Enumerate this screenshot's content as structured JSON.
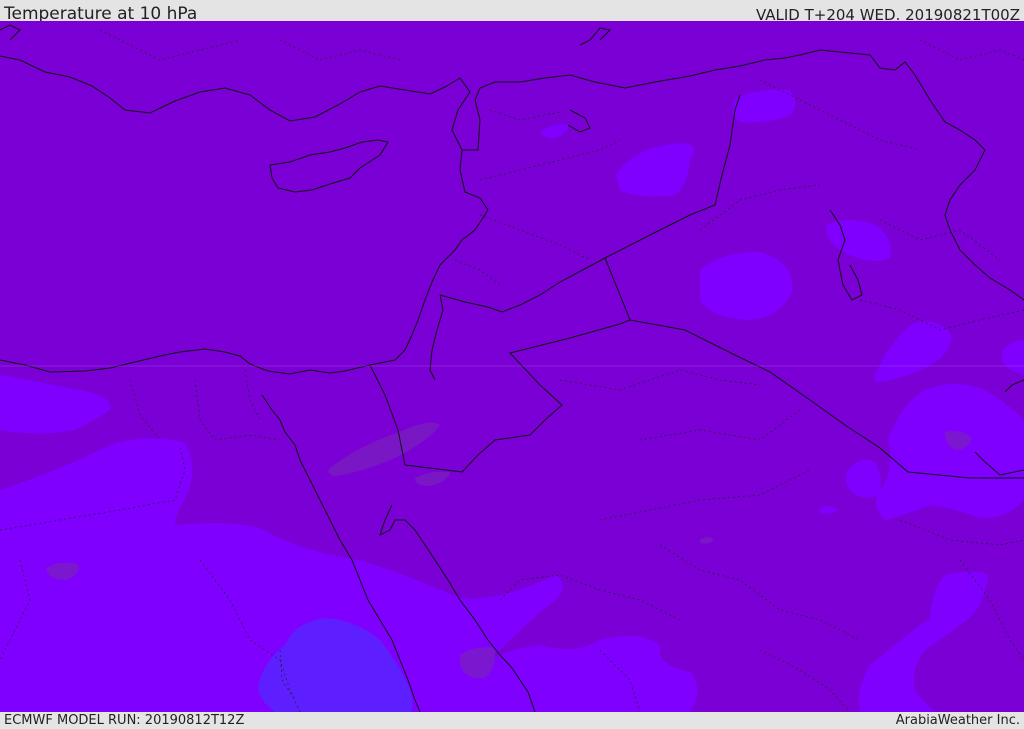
{
  "header": {
    "title": "Temperature at 10 hPa",
    "valid": "VALID T+204 WED. 20190821T00Z"
  },
  "footer": {
    "model_run": "ECMWF MODEL RUN: 20190812T12Z",
    "brand": "ArabiaWeather Inc."
  },
  "colors": {
    "base_fill": "#7a00d6",
    "cooler_fill": "#7f00ff",
    "coldest_fill": "#5d1fff",
    "warm_patch": "#7a1fbf",
    "coastline": "#111111",
    "border": "#111111"
  }
}
